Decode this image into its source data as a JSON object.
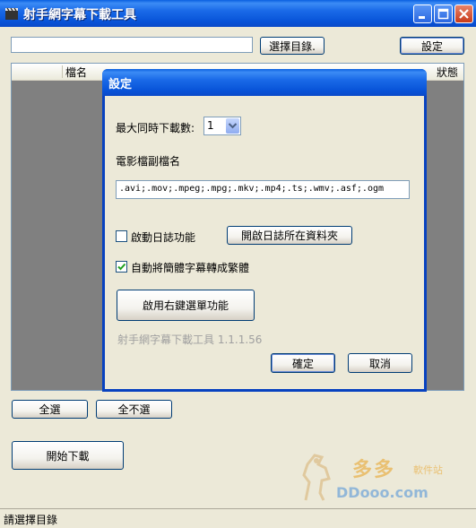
{
  "window": {
    "title": "射手網字幕下載工具",
    "icon": "clapperboard-icon",
    "controls": [
      "minimize-icon",
      "maximize-icon",
      "close-icon"
    ]
  },
  "toolbar": {
    "path_value": "",
    "browse_label": "選擇目錄.",
    "settings_label": "設定"
  },
  "list": {
    "col_name": "檔名",
    "col_right": "狀態"
  },
  "bottom": {
    "select_all": "全選",
    "select_none": "全不選",
    "start_download": "開始下載"
  },
  "status": {
    "text": "請選擇目錄"
  },
  "watermark": {
    "cn": "多多",
    "sub": "軟件站",
    "url": "DDooo.com"
  },
  "dialog": {
    "title": "設定",
    "max_downloads_label": "最大同時下載數:",
    "max_downloads_value": "1",
    "ext_label": "電影檔副檔名",
    "ext_value": ".avi;.mov;.mpeg;.mpg;.mkv;.mp4;.ts;.wmv;.asf;.ogm",
    "log_enable_label": "啟動日誌功能",
    "log_enable_checked": false,
    "open_log_folder_label": "開啟日誌所在資料夾",
    "auto_convert_label": "自動將簡體字幕轉成繁體",
    "auto_convert_checked": true,
    "context_menu_label": "啟用右鍵選單功能",
    "version": "射手網字幕下載工具 1.1.1.56",
    "ok_label": "確定",
    "cancel_label": "取消"
  },
  "colors": {
    "titlebar": "#0853D8",
    "window_bg": "#ECE9D8",
    "list_bg": "#808080"
  }
}
